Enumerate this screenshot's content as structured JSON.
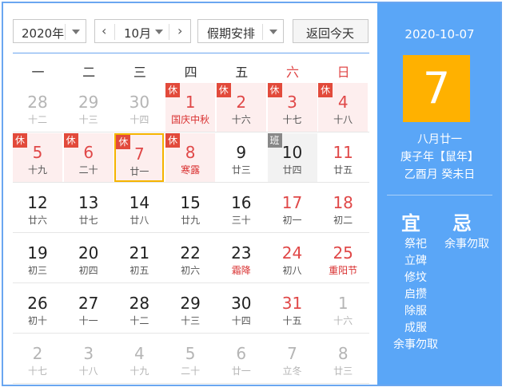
{
  "toolbar": {
    "year": "2020年",
    "month": "10月",
    "holiday_select": "假期安排",
    "today_button": "返回今天"
  },
  "weekdays": [
    "一",
    "二",
    "三",
    "四",
    "五",
    "六",
    "日"
  ],
  "calendar": [
    [
      {
        "d": "28",
        "l": "十二",
        "muted": true
      },
      {
        "d": "29",
        "l": "十三",
        "muted": true
      },
      {
        "d": "30",
        "l": "十四",
        "muted": true
      },
      {
        "d": "1",
        "l": "国庆中秋",
        "badge": "休",
        "holiday": true,
        "fest": true
      },
      {
        "d": "2",
        "l": "十六",
        "badge": "休",
        "holiday": true
      },
      {
        "d": "3",
        "l": "十七",
        "badge": "休",
        "holiday": true
      },
      {
        "d": "4",
        "l": "十八",
        "badge": "休",
        "holiday": true
      }
    ],
    [
      {
        "d": "5",
        "l": "十九",
        "badge": "休",
        "holiday": true
      },
      {
        "d": "6",
        "l": "二十",
        "badge": "休",
        "holiday": true
      },
      {
        "d": "7",
        "l": "廿一",
        "badge": "休",
        "holiday": true,
        "selected": true
      },
      {
        "d": "8",
        "l": "寒露",
        "badge": "休",
        "holiday": true,
        "fest": true
      },
      {
        "d": "9",
        "l": "廿三"
      },
      {
        "d": "10",
        "l": "廿四",
        "badge": "班",
        "workday": true
      },
      {
        "d": "11",
        "l": "廿五",
        "red": true
      }
    ],
    [
      {
        "d": "12",
        "l": "廿六"
      },
      {
        "d": "13",
        "l": "廿七"
      },
      {
        "d": "14",
        "l": "廿八"
      },
      {
        "d": "15",
        "l": "廿九"
      },
      {
        "d": "16",
        "l": "三十"
      },
      {
        "d": "17",
        "l": "初一",
        "red": true
      },
      {
        "d": "18",
        "l": "初二",
        "red": true
      }
    ],
    [
      {
        "d": "19",
        "l": "初三"
      },
      {
        "d": "20",
        "l": "初四"
      },
      {
        "d": "21",
        "l": "初五"
      },
      {
        "d": "22",
        "l": "初六"
      },
      {
        "d": "23",
        "l": "霜降",
        "fest": true
      },
      {
        "d": "24",
        "l": "初八",
        "red": true
      },
      {
        "d": "25",
        "l": "重阳节",
        "red": true,
        "fest": true
      }
    ],
    [
      {
        "d": "26",
        "l": "初十"
      },
      {
        "d": "27",
        "l": "十一"
      },
      {
        "d": "28",
        "l": "十二"
      },
      {
        "d": "29",
        "l": "十三"
      },
      {
        "d": "30",
        "l": "十四"
      },
      {
        "d": "31",
        "l": "十五",
        "red": true
      },
      {
        "d": "1",
        "l": "十六",
        "muted": true
      }
    ],
    [
      {
        "d": "2",
        "l": "十七",
        "muted": true
      },
      {
        "d": "3",
        "l": "十八",
        "muted": true
      },
      {
        "d": "4",
        "l": "十九",
        "muted": true
      },
      {
        "d": "5",
        "l": "二十",
        "muted": true
      },
      {
        "d": "6",
        "l": "廿一",
        "muted": true
      },
      {
        "d": "7",
        "l": "立冬",
        "muted": true
      },
      {
        "d": "8",
        "l": "廿三",
        "muted": true
      }
    ]
  ],
  "side": {
    "date": "2020-10-07",
    "day": "7",
    "lunar": "八月廿一",
    "ganzhi_year": "庚子年【鼠年】",
    "ganzhi_day": "乙酉月 癸未日",
    "yi_label": "宜",
    "ji_label": "忌",
    "yi_items": [
      "祭祀",
      "立碑",
      "修坟",
      "启攒",
      "除服",
      "成服",
      "余事勿取"
    ],
    "ji_items": [
      "余事勿取"
    ]
  },
  "colors": {
    "accent": "#5aa6f7",
    "holiday_bg": "#fdeeee",
    "red": "#e04848",
    "selected_border": "#f5b400",
    "big_day_bg": "#ffb100"
  }
}
